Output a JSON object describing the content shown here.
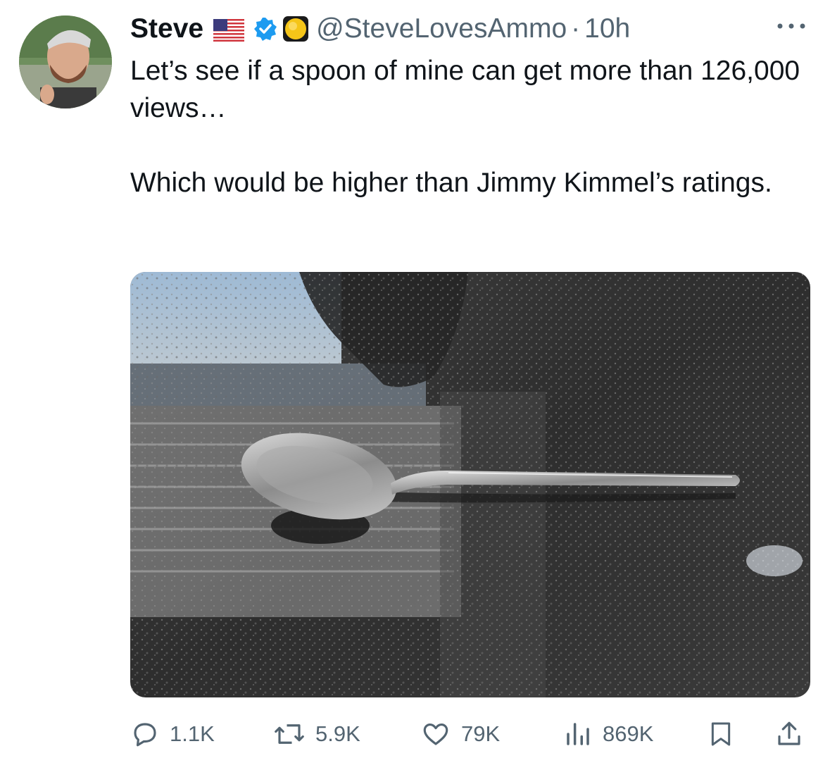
{
  "tweet": {
    "name": "Steve",
    "handle": "@SteveLovesAmmo",
    "separator": "·",
    "time": "10h",
    "text": "Let’s see if a spoon of mine can get more than 126,000 views…\n\nWhich would be higher than Jimmy Kimmel’s ratings."
  },
  "icons": {
    "flag": "us-flag-icon",
    "verified": "verified-badge-icon",
    "gold": "gold-circle-icon",
    "more": "more-icon",
    "reply": "reply-icon",
    "retweet": "retweet-icon",
    "like": "heart-icon",
    "views": "views-icon",
    "bookmark": "bookmark-icon",
    "share": "share-icon"
  },
  "actions": {
    "replies": "1.1K",
    "retweets": "5.9K",
    "likes": "79K",
    "views": "869K"
  },
  "colors": {
    "text": "#0f1419",
    "secondary": "#536471",
    "verified": "#1d9bf0",
    "gold": "#f5c518"
  }
}
